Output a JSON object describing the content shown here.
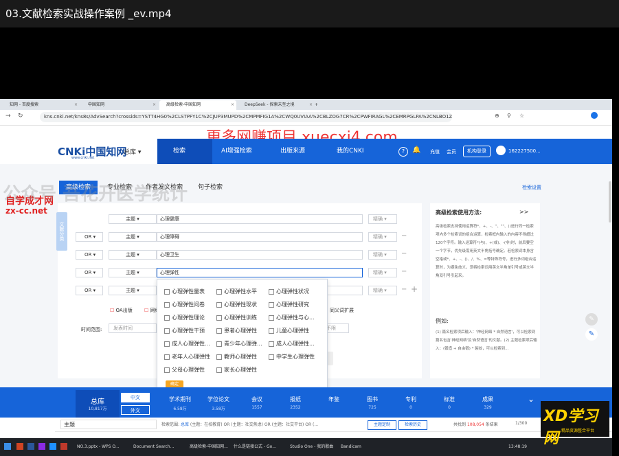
{
  "video_title": "03.文献检索实战操作案例 _ev.mp4",
  "browser": {
    "tabs": [
      "知网 - 百度搜索",
      "中国知网",
      "高级检索-中国知网",
      "DeepSeek - 探索未至之境"
    ],
    "new_tab": "+",
    "url": "kns.cnki.net/kns8s/AdvSearch?crossids=YSTT4HG0%2CLSTPFY1C%2CJUP3MUPD%2CMPMFIG1A%2CWQ0UVIAA%2CBLZOG7CR%2CPWFIRAGL%2CEMRPGLPA%2CNLBO1Z6R%2CNN3FJMUV"
  },
  "cnki": {
    "logo": "CNKi中国知网",
    "logo_sub": "www.cnki.net",
    "zongku": "总库",
    "nav": [
      "检索",
      "AI增强检索",
      "出版来源",
      "我的CNKI"
    ],
    "user": [
      "充值",
      "会员",
      "机构登录",
      "162227500..."
    ]
  },
  "search_tabs": [
    "高级检索",
    "专业检索",
    "作者发文检索",
    "句子检索"
  ],
  "search_settings": "检索设置",
  "side_tab": "文献分类",
  "rows": [
    {
      "logic": "",
      "field": "主题",
      "value": "心理健康",
      "match": "精确"
    },
    {
      "logic": "OR",
      "field": "主题",
      "value": "心理障碍",
      "match": "精确"
    },
    {
      "logic": "OR",
      "field": "主题",
      "value": "心理卫生",
      "match": "精确"
    },
    {
      "logic": "OR",
      "field": "主题",
      "value": "心理弹性",
      "match": "精确"
    },
    {
      "logic": "OR",
      "field": "主题",
      "value": "",
      "match": "精确"
    }
  ],
  "options": [
    "OA出版",
    "网络首发",
    "增强出版",
    "基金文献",
    "中英文扩展",
    "同义词扩展"
  ],
  "time_label": "时间范围:",
  "time_start": "发表时间",
  "time_any": "不限",
  "dropdown": [
    "心理弹性量表",
    "心理弹性水平",
    "心理弹性状况",
    "心理弹性问卷",
    "心理弹性现状",
    "心理弹性研究",
    "心理弹性理论",
    "心理弹性训练",
    "心理弹性与心...",
    "心理弹性干预",
    "患者心理弹性",
    "儿童心理弹性",
    "成人心理弹性...",
    "青少年心理弹...",
    "成人心理弹性...",
    "老年人心理弹性",
    "教师心理弹性",
    "中学生心理弹性",
    "父母心理弹性",
    "家长心理弹性"
  ],
  "dropdown_confirm": "确定",
  "help": {
    "title": "高级检索使用方法:",
    "arrow": ">>",
    "body": "高级检索支持使用运算符*、+、-、''、\"\"、()进行同一检索项内多个检索词的组合运算，检索框内输入的内容不得超过120个字符。输入运算符*(与)、+(或)、-(非)时，前后要空一个字节，优先级需用英文半角括号确定。若检索词本身含空格或*、+、-、()、/、%、=等特殊符号，进行多词组合运算时，为避免歧义，须将检索词用英文半角单引号或英文半角双引号引起来。",
    "example_title": "例如:",
    "example": "(1) 篇名检索项后输入：'神经网络 * 自然语言'，可以检索到篇名包含'神经网络'及'自然语言'的文献。(2) 主题检索项后输入：(锻造 + 自由锻) * 裂纹，可以检索到..."
  },
  "bottom": {
    "zongku": "总库",
    "zongku_num": "10,817万",
    "zh": "中文",
    "en": "外文",
    "cats": [
      {
        "name": "学术期刊",
        "num": "6.58万"
      },
      {
        "name": "学位论文",
        "num": "3.58万"
      },
      {
        "name": "会议",
        "num": "1557"
      },
      {
        "name": "报纸",
        "num": "2352"
      },
      {
        "name": "年鉴",
        "num": ""
      },
      {
        "name": "图书",
        "num": "725"
      },
      {
        "name": "专利",
        "num": "0"
      },
      {
        "name": "标准",
        "num": "0"
      },
      {
        "name": "成果",
        "num": "329"
      }
    ]
  },
  "result": {
    "topic": "主题",
    "scope_label": "检索范围:",
    "scope_value": "总库",
    "query": "(主题：在校教育) OR (主题：社交焦虑) OR (主题：社交平台) OR (...",
    "theme_btn": "主题定制",
    "history_btn": "检索历史",
    "count_label": "共找到",
    "count": "108,054",
    "count_unit": "条结果",
    "page": "1/300"
  },
  "taskbar": {
    "items": [
      "NO.3.pptx - WPS O...",
      "Document Search...",
      "高级检索-中国知网...",
      "什么是链接公式 - Go...",
      "Studio One - 我的歌曲",
      "Bandicam"
    ],
    "time": "13:48:19"
  },
  "watermarks": {
    "top": "更多网赚项目 xuecxi4.com",
    "left_cn": "自学成才网",
    "left_url": "zx-cc.net",
    "faded": "公众号 吾花开医学统计",
    "xd": "XD学习网",
    "xd_sub": "精品资源整合平台"
  }
}
